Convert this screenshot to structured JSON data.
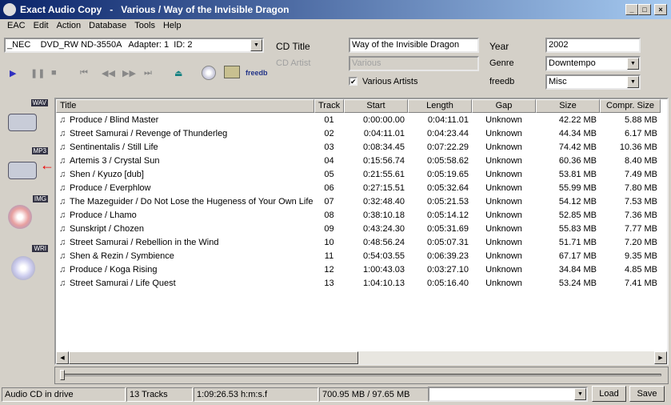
{
  "window": {
    "title": "Exact Audio Copy   -   Various / Way of the Invisible Dragon",
    "logo": "EAC"
  },
  "menu": [
    "EAC",
    "Edit",
    "Action",
    "Database",
    "Tools",
    "Help"
  ],
  "drive": "_NEC    DVD_RW ND-3550A   Adapter: 1  ID: 2",
  "labels": {
    "cd_title": "CD Title",
    "cd_artist": "CD Artist",
    "year": "Year",
    "genre": "Genre",
    "freedb": "freedb",
    "various": "Various Artists"
  },
  "values": {
    "cd_title": "Way of the Invisible Dragon",
    "cd_artist": "Various",
    "year": "2002",
    "genre": "Downtempo",
    "freedb": "Misc",
    "various_checked": true
  },
  "toolbar": {
    "freedb_label": "freedb"
  },
  "left_icons": [
    "WAV",
    "MP3",
    "IMG",
    "WRI"
  ],
  "columns": [
    "Title",
    "Track",
    "Start",
    "Length",
    "Gap",
    "Size",
    "Compr. Size"
  ],
  "tracks": [
    [
      "Produce / Blind Master",
      "01",
      "0:00:00.00",
      "0:04:11.01",
      "Unknown",
      "42.22 MB",
      "5.88 MB"
    ],
    [
      "Street Samurai / Revenge of Thunderleg",
      "02",
      "0:04:11.01",
      "0:04:23.44",
      "Unknown",
      "44.34 MB",
      "6.17 MB"
    ],
    [
      "Sentinentalis / Still Life",
      "03",
      "0:08:34.45",
      "0:07:22.29",
      "Unknown",
      "74.42 MB",
      "10.36 MB"
    ],
    [
      "Artemis 3 / Crystal Sun",
      "04",
      "0:15:56.74",
      "0:05:58.62",
      "Unknown",
      "60.36 MB",
      "8.40 MB"
    ],
    [
      "Shen / Kyuzo [dub]",
      "05",
      "0:21:55.61",
      "0:05:19.65",
      "Unknown",
      "53.81 MB",
      "7.49 MB"
    ],
    [
      "Produce / Everphlow",
      "06",
      "0:27:15.51",
      "0:05:32.64",
      "Unknown",
      "55.99 MB",
      "7.80 MB"
    ],
    [
      "The Mazeguider / Do Not Lose the Hugeness of Your Own Life",
      "07",
      "0:32:48.40",
      "0:05:21.53",
      "Unknown",
      "54.12 MB",
      "7.53 MB"
    ],
    [
      "Produce / Lhamo",
      "08",
      "0:38:10.18",
      "0:05:14.12",
      "Unknown",
      "52.85 MB",
      "7.36 MB"
    ],
    [
      "Sunskript / Chozen",
      "09",
      "0:43:24.30",
      "0:05:31.69",
      "Unknown",
      "55.83 MB",
      "7.77 MB"
    ],
    [
      "Street Samurai / Rebellion in the Wind",
      "10",
      "0:48:56.24",
      "0:05:07.31",
      "Unknown",
      "51.71 MB",
      "7.20 MB"
    ],
    [
      "Shen & Rezin / Symbience",
      "11",
      "0:54:03.55",
      "0:06:39.23",
      "Unknown",
      "67.17 MB",
      "9.35 MB"
    ],
    [
      "Produce / Koga Rising",
      "12",
      "1:00:43.03",
      "0:03:27.10",
      "Unknown",
      "34.84 MB",
      "4.85 MB"
    ],
    [
      "Street Samurai / Life Quest",
      "13",
      "1:04:10.13",
      "0:05:16.40",
      "Unknown",
      "53.24 MB",
      "7.41 MB"
    ]
  ],
  "status": {
    "drive": "Audio CD in drive",
    "tracks": "13 Tracks",
    "length": "1:09:26.53 h:m:s.f",
    "size": "700.95 MB / 97.65 MB",
    "load": "Load",
    "save": "Save"
  }
}
